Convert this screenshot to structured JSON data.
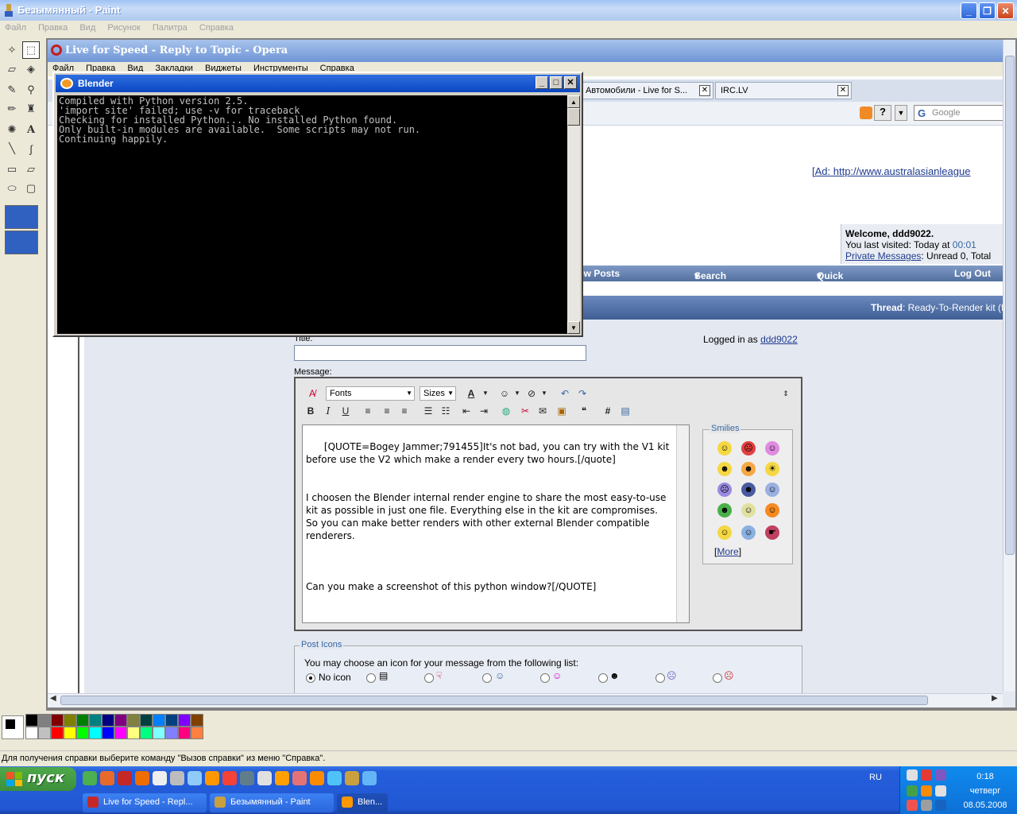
{
  "paint": {
    "title": "Безымянный - Paint",
    "menu": [
      "Файл",
      "Правка",
      "Вид",
      "Рисунок",
      "Палитра",
      "Справка"
    ],
    "status": "Для получения справки выберите команду \"Вызов справки\" из меню \"Справка\".",
    "palette_row1": [
      "#000000",
      "#808080",
      "#800000",
      "#808000",
      "#008000",
      "#008080",
      "#000080",
      "#800080",
      "#808040",
      "#004040",
      "#0080ff",
      "#004080",
      "#8000ff",
      "#804000"
    ],
    "palette_row2": [
      "#ffffff",
      "#c0c0c0",
      "#ff0000",
      "#ffff00",
      "#00ff00",
      "#00ffff",
      "#0000ff",
      "#ff00ff",
      "#ffff80",
      "#00ff80",
      "#80ffff",
      "#8080ff",
      "#ff0080",
      "#ff8040"
    ]
  },
  "opera": {
    "title": "Live for Speed - Reply to Topic - Opera",
    "menu": [
      "Файл",
      "Правка",
      "Вид",
      "Закладки",
      "Виджеты",
      "Инструменты",
      "Справка"
    ],
    "tabs": [
      {
        "label": "Автомобили - Live for S..."
      },
      {
        "label": "IRC.LV"
      }
    ],
    "search_placeholder": "Google",
    "ad_link": "[Ad: http://www.australasianleague",
    "welcome": {
      "greeting": "Welcome, ddd9022.",
      "last_visited_prefix": "You last visited: Today at ",
      "last_visited_time": "00:01",
      "pm_link": "Private Messages",
      "pm_suffix": ": Unread 0, Total"
    },
    "nav": {
      "new_posts": "ew Posts",
      "search": "Search",
      "quick_links": "Quick Links",
      "log_out": "Log Out"
    },
    "thread": {
      "label": "Thread",
      "value": ": Ready-To-Render kit (fre"
    },
    "form": {
      "title_label": "Title:",
      "logged_in_prefix": "Logged in as ",
      "username": "ddd9022",
      "message_label": "Message:",
      "fonts": "Fonts",
      "sizes": "Sizes",
      "message_text": "[QUOTE=Bogey Jammer;791455]It's not bad, you can try with the V1 kit before use the V2 which make a render every two hours.[/quote]\n\n\nI choosen the Blender internal render engine to share the most easy-to-use kit as possible in just one file. Everything else in the kit are compromises. So you can make better renders with other external Blender compatible renderers.\n\n\n\nCan you make a screenshot of this python window?[/QUOTE]",
      "smilies_legend": "Smilies",
      "more_link": "More",
      "post_icons_legend": "Post Icons",
      "post_icons_text": "You may choose an icon for your message from the following list:",
      "no_icon": "No icon"
    }
  },
  "blender": {
    "title": "Blender",
    "console_lines": [
      "Compiled with Python version 2.5.",
      "'import site' failed; use -v for traceback",
      "Checking for installed Python... No installed Python found.",
      "Only built-in modules are available.  Some scripts may not run.",
      "Continuing happily."
    ]
  },
  "taskbar": {
    "start": "пуск",
    "tasks": [
      {
        "label": "Live for Speed - Repl..."
      },
      {
        "label": "Безымянный - Paint"
      },
      {
        "label": "Blen..."
      }
    ],
    "lang": "RU",
    "time": "0:18",
    "day": "четверг",
    "date": "08.05.2008"
  }
}
